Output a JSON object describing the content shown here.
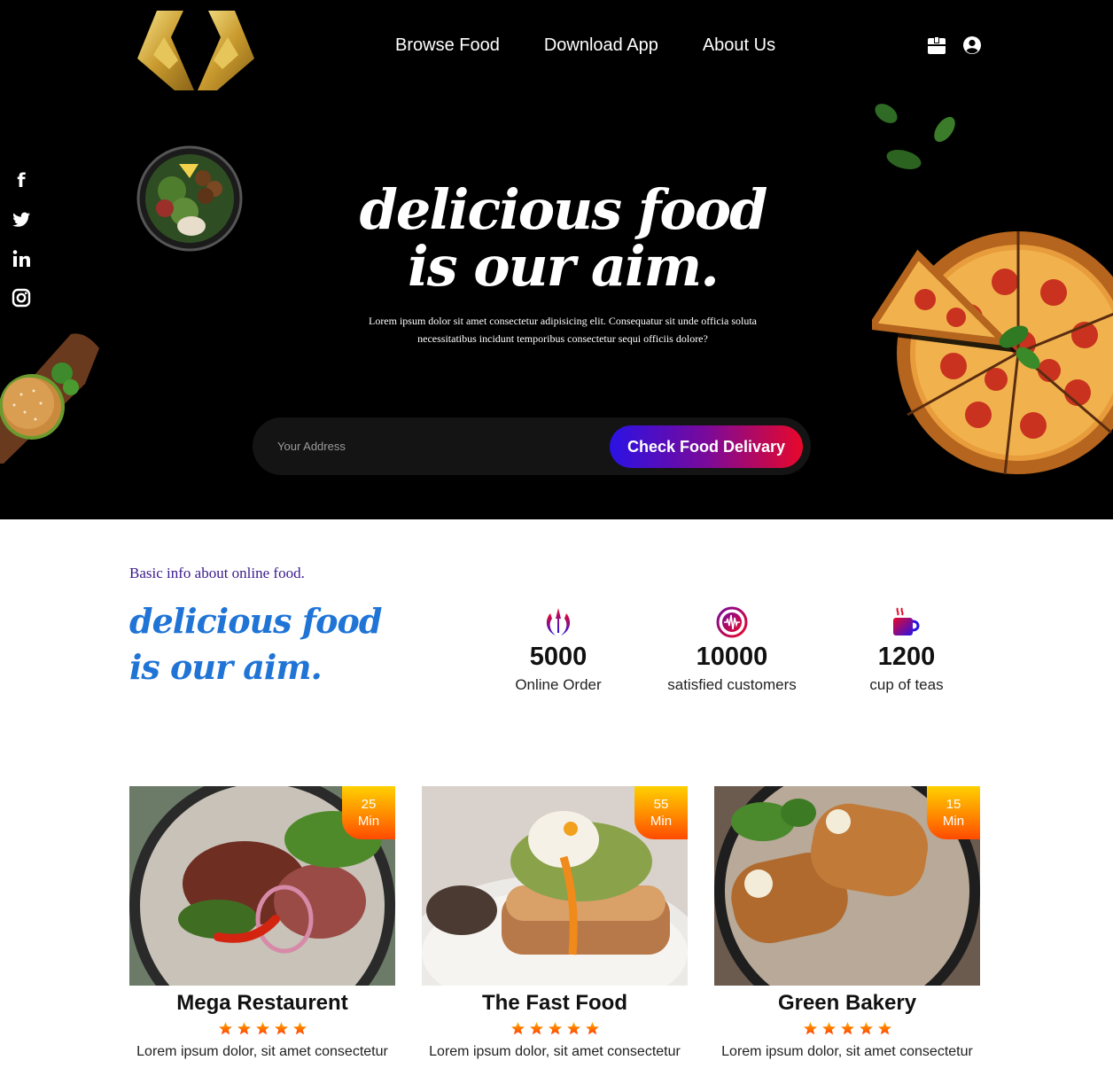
{
  "nav": {
    "links": [
      "Browse Food",
      "Download App",
      "About Us"
    ],
    "icons": [
      "cart-icon",
      "user-icon"
    ]
  },
  "social": [
    "facebook-icon",
    "twitter-icon",
    "linkedin-icon",
    "instagram-icon"
  ],
  "hero": {
    "title_line1": "delicious food",
    "title_line2": "is our aim.",
    "description": "Lorem ipsum dolor sit amet consectetur adipisicing elit. Consequatur sit unde officia soluta necessitatibus incidunt temporibus consectetur sequi officiis dolore?",
    "search_placeholder": "Your Address",
    "search_button": "Check Food Delivary"
  },
  "info": {
    "kicker": "Basic info about online food.",
    "title": "delicious food is our aim.",
    "stats": [
      {
        "value": "5000",
        "label": "Online Order",
        "icon": "jedi-icon"
      },
      {
        "value": "10000",
        "label": "satisfied customers",
        "icon": "record-vinyl-icon"
      },
      {
        "value": "1200",
        "label": "cup of teas",
        "icon": "hot-mug-icon"
      }
    ]
  },
  "cards": [
    {
      "time": "25",
      "unit": "Min",
      "name": "Mega Restaurent",
      "rating": 5,
      "desc": "Lorem ipsum dolor, sit amet consectetur"
    },
    {
      "time": "55",
      "unit": "Min",
      "name": "The Fast Food",
      "rating": 5,
      "desc": "Lorem ipsum dolor, sit amet consectetur"
    },
    {
      "time": "15",
      "unit": "Min",
      "name": "Green Bakery",
      "rating": 5,
      "desc": "Lorem ipsum dolor, sit amet consectetur"
    }
  ],
  "colors": {
    "hero_bg": "#000000",
    "accent_blue": "#1f74d6",
    "kicker_purple": "#3a1a8c",
    "button_gradient_start": "#2a12e4",
    "button_gradient_end": "#e8082a",
    "badge_gradient_start": "#ffd000",
    "badge_gradient_end": "#ff4a00"
  }
}
